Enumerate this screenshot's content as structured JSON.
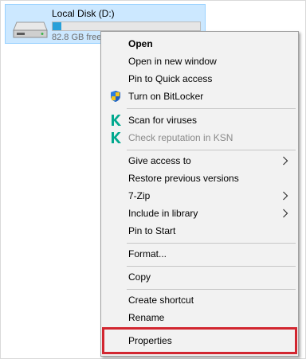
{
  "drive": {
    "name": "Local Disk (D:)",
    "free_text": "82.8 GB free",
    "usage_fraction": 0.06
  },
  "menu": {
    "items": [
      {
        "label": "Open"
      },
      {
        "label": "Open in new window"
      },
      {
        "label": "Pin to Quick access"
      },
      {
        "label": "Turn on BitLocker"
      },
      {
        "label": "Scan for viruses"
      },
      {
        "label": "Check reputation in KSN"
      },
      {
        "label": "Give access to"
      },
      {
        "label": "Restore previous versions"
      },
      {
        "label": "7-Zip"
      },
      {
        "label": "Include in library"
      },
      {
        "label": "Pin to Start"
      },
      {
        "label": "Format..."
      },
      {
        "label": "Copy"
      },
      {
        "label": "Create shortcut"
      },
      {
        "label": "Rename"
      },
      {
        "label": "Properties"
      }
    ]
  },
  "icons": {
    "bitlocker": "shield-icon",
    "kaspersky": "kaspersky-k-icon",
    "submenu": "chevron-right-icon",
    "drive": "hard-drive-icon"
  },
  "colors": {
    "selection_bg": "#cce8ff",
    "usage_bar": "#26a0da",
    "highlight_border": "#d22630",
    "kaspersky_green": "#00a88e"
  }
}
